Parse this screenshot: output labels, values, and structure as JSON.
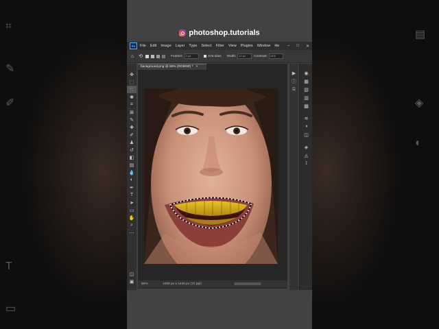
{
  "watermark": {
    "text": "photoshop.tutorials",
    "icon": "instagram-icon"
  },
  "menubar": {
    "app_badge": "Ps",
    "items": [
      "File",
      "Edit",
      "Image",
      "Layer",
      "Type",
      "Select",
      "Filter",
      "View",
      "Plugins",
      "Window",
      "He"
    ],
    "window_controls": [
      "–",
      "□",
      "✕"
    ]
  },
  "options_bar": {
    "feather_label": "Feather:",
    "feather_value": "0 px",
    "anti_alias_label": "Anti-alias",
    "width_label": "Width:",
    "width_value": "10 px",
    "contrast_label": "Contrast:",
    "contrast_value": "10%"
  },
  "document": {
    "tab_title": "background.png @ 50% (RGB/8#) *",
    "tab_close": "×",
    "zoom": "50%",
    "doc_info": "1080 px x 1440 px (72 ppi)"
  },
  "swatches": {
    "foreground": "#e0128a",
    "background": "#ffffff"
  },
  "colors": {
    "ui_dark": "#262626",
    "ui_mid": "#424242",
    "menubar": "#2f2f2f",
    "accent": "#4fb5ff"
  }
}
